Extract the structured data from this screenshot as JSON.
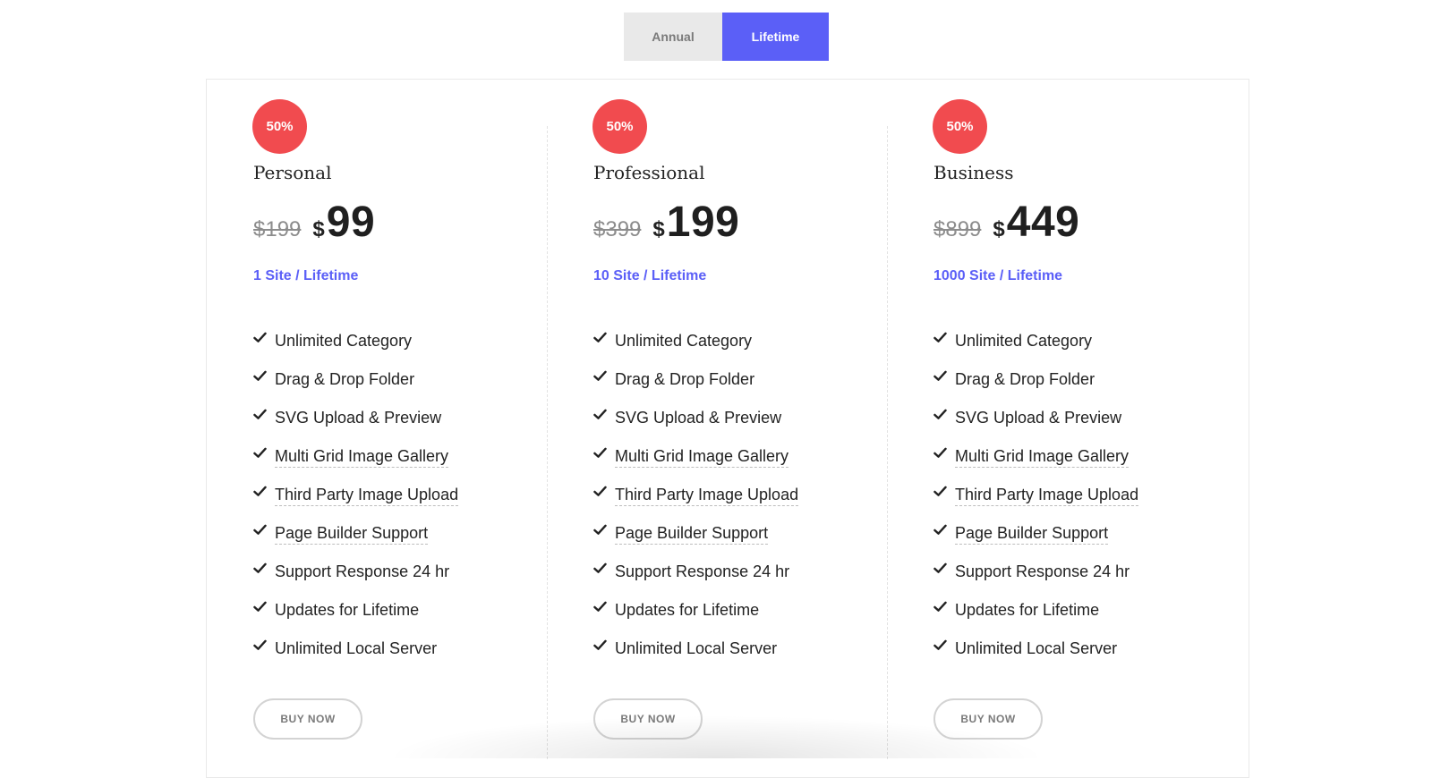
{
  "billing_toggle": {
    "annual_label": "Annual",
    "lifetime_label": "Lifetime",
    "active": "Lifetime"
  },
  "colors": {
    "accent": "#5b5ff7",
    "badge": "#f14b4f",
    "toggle_inactive": "#e9e9e9"
  },
  "plans": [
    {
      "badge": "50%",
      "name": "Personal",
      "old_price": "$199",
      "currency": "$",
      "price": "99",
      "period": "1 Site / Lifetime",
      "buy_label": "BUY NOW",
      "features": [
        {
          "label": "Unlimited Category",
          "dotted": false
        },
        {
          "label": "Drag & Drop Folder",
          "dotted": false
        },
        {
          "label": "SVG Upload & Preview",
          "dotted": false
        },
        {
          "label": "Multi Grid Image Gallery",
          "dotted": true
        },
        {
          "label": "Third Party Image Upload",
          "dotted": true
        },
        {
          "label": "Page Builder Support",
          "dotted": true
        },
        {
          "label": "Support Response 24 hr",
          "dotted": false
        },
        {
          "label": "Updates for Lifetime",
          "dotted": false
        },
        {
          "label": "Unlimited Local Server",
          "dotted": false
        }
      ]
    },
    {
      "badge": "50%",
      "name": "Professional",
      "old_price": "$399",
      "currency": "$",
      "price": "199",
      "period": "10 Site / Lifetime",
      "buy_label": "BUY NOW",
      "features": [
        {
          "label": "Unlimited Category",
          "dotted": false
        },
        {
          "label": "Drag & Drop Folder",
          "dotted": false
        },
        {
          "label": "SVG Upload & Preview",
          "dotted": false
        },
        {
          "label": "Multi Grid Image Gallery",
          "dotted": true
        },
        {
          "label": "Third Party Image Upload",
          "dotted": true
        },
        {
          "label": "Page Builder Support",
          "dotted": true
        },
        {
          "label": "Support Response 24 hr",
          "dotted": false
        },
        {
          "label": "Updates for Lifetime",
          "dotted": false
        },
        {
          "label": "Unlimited Local Server",
          "dotted": false
        }
      ]
    },
    {
      "badge": "50%",
      "name": "Business",
      "old_price": "$899",
      "currency": "$",
      "price": "449",
      "period": "1000 Site / Lifetime",
      "buy_label": "BUY NOW",
      "features": [
        {
          "label": "Unlimited Category",
          "dotted": false
        },
        {
          "label": "Drag & Drop Folder",
          "dotted": false
        },
        {
          "label": "SVG Upload & Preview",
          "dotted": false
        },
        {
          "label": "Multi Grid Image Gallery",
          "dotted": true
        },
        {
          "label": "Third Party Image Upload",
          "dotted": true
        },
        {
          "label": "Page Builder Support",
          "dotted": true
        },
        {
          "label": "Support Response 24 hr",
          "dotted": false
        },
        {
          "label": "Updates for Lifetime",
          "dotted": false
        },
        {
          "label": "Unlimited Local Server",
          "dotted": false
        }
      ]
    }
  ]
}
